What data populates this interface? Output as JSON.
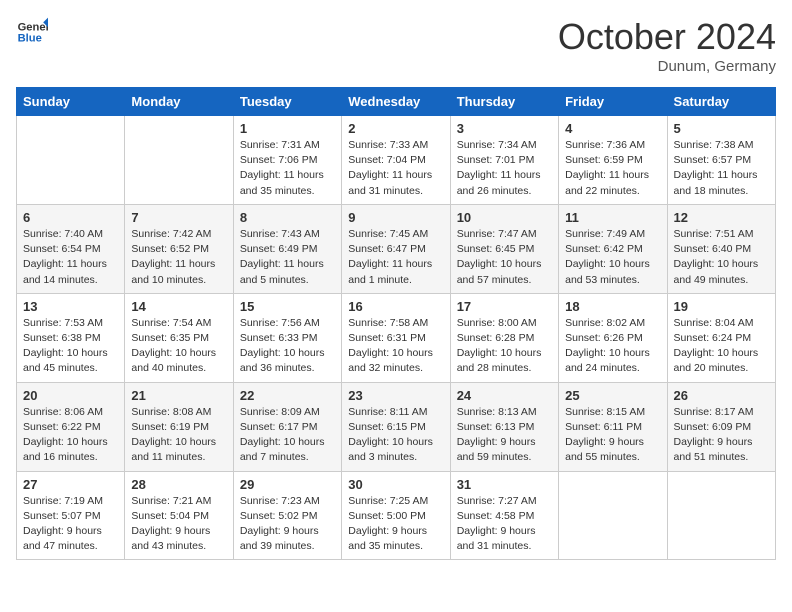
{
  "header": {
    "logo_general": "General",
    "logo_blue": "Blue",
    "title": "October 2024",
    "location": "Dunum, Germany"
  },
  "weekdays": [
    "Sunday",
    "Monday",
    "Tuesday",
    "Wednesday",
    "Thursday",
    "Friday",
    "Saturday"
  ],
  "weeks": [
    [
      {
        "day": "",
        "info": ""
      },
      {
        "day": "",
        "info": ""
      },
      {
        "day": "1",
        "info": "Sunrise: 7:31 AM\nSunset: 7:06 PM\nDaylight: 11 hours and 35 minutes."
      },
      {
        "day": "2",
        "info": "Sunrise: 7:33 AM\nSunset: 7:04 PM\nDaylight: 11 hours and 31 minutes."
      },
      {
        "day": "3",
        "info": "Sunrise: 7:34 AM\nSunset: 7:01 PM\nDaylight: 11 hours and 26 minutes."
      },
      {
        "day": "4",
        "info": "Sunrise: 7:36 AM\nSunset: 6:59 PM\nDaylight: 11 hours and 22 minutes."
      },
      {
        "day": "5",
        "info": "Sunrise: 7:38 AM\nSunset: 6:57 PM\nDaylight: 11 hours and 18 minutes."
      }
    ],
    [
      {
        "day": "6",
        "info": "Sunrise: 7:40 AM\nSunset: 6:54 PM\nDaylight: 11 hours and 14 minutes."
      },
      {
        "day": "7",
        "info": "Sunrise: 7:42 AM\nSunset: 6:52 PM\nDaylight: 11 hours and 10 minutes."
      },
      {
        "day": "8",
        "info": "Sunrise: 7:43 AM\nSunset: 6:49 PM\nDaylight: 11 hours and 5 minutes."
      },
      {
        "day": "9",
        "info": "Sunrise: 7:45 AM\nSunset: 6:47 PM\nDaylight: 11 hours and 1 minute."
      },
      {
        "day": "10",
        "info": "Sunrise: 7:47 AM\nSunset: 6:45 PM\nDaylight: 10 hours and 57 minutes."
      },
      {
        "day": "11",
        "info": "Sunrise: 7:49 AM\nSunset: 6:42 PM\nDaylight: 10 hours and 53 minutes."
      },
      {
        "day": "12",
        "info": "Sunrise: 7:51 AM\nSunset: 6:40 PM\nDaylight: 10 hours and 49 minutes."
      }
    ],
    [
      {
        "day": "13",
        "info": "Sunrise: 7:53 AM\nSunset: 6:38 PM\nDaylight: 10 hours and 45 minutes."
      },
      {
        "day": "14",
        "info": "Sunrise: 7:54 AM\nSunset: 6:35 PM\nDaylight: 10 hours and 40 minutes."
      },
      {
        "day": "15",
        "info": "Sunrise: 7:56 AM\nSunset: 6:33 PM\nDaylight: 10 hours and 36 minutes."
      },
      {
        "day": "16",
        "info": "Sunrise: 7:58 AM\nSunset: 6:31 PM\nDaylight: 10 hours and 32 minutes."
      },
      {
        "day": "17",
        "info": "Sunrise: 8:00 AM\nSunset: 6:28 PM\nDaylight: 10 hours and 28 minutes."
      },
      {
        "day": "18",
        "info": "Sunrise: 8:02 AM\nSunset: 6:26 PM\nDaylight: 10 hours and 24 minutes."
      },
      {
        "day": "19",
        "info": "Sunrise: 8:04 AM\nSunset: 6:24 PM\nDaylight: 10 hours and 20 minutes."
      }
    ],
    [
      {
        "day": "20",
        "info": "Sunrise: 8:06 AM\nSunset: 6:22 PM\nDaylight: 10 hours and 16 minutes."
      },
      {
        "day": "21",
        "info": "Sunrise: 8:08 AM\nSunset: 6:19 PM\nDaylight: 10 hours and 11 minutes."
      },
      {
        "day": "22",
        "info": "Sunrise: 8:09 AM\nSunset: 6:17 PM\nDaylight: 10 hours and 7 minutes."
      },
      {
        "day": "23",
        "info": "Sunrise: 8:11 AM\nSunset: 6:15 PM\nDaylight: 10 hours and 3 minutes."
      },
      {
        "day": "24",
        "info": "Sunrise: 8:13 AM\nSunset: 6:13 PM\nDaylight: 9 hours and 59 minutes."
      },
      {
        "day": "25",
        "info": "Sunrise: 8:15 AM\nSunset: 6:11 PM\nDaylight: 9 hours and 55 minutes."
      },
      {
        "day": "26",
        "info": "Sunrise: 8:17 AM\nSunset: 6:09 PM\nDaylight: 9 hours and 51 minutes."
      }
    ],
    [
      {
        "day": "27",
        "info": "Sunrise: 7:19 AM\nSunset: 5:07 PM\nDaylight: 9 hours and 47 minutes."
      },
      {
        "day": "28",
        "info": "Sunrise: 7:21 AM\nSunset: 5:04 PM\nDaylight: 9 hours and 43 minutes."
      },
      {
        "day": "29",
        "info": "Sunrise: 7:23 AM\nSunset: 5:02 PM\nDaylight: 9 hours and 39 minutes."
      },
      {
        "day": "30",
        "info": "Sunrise: 7:25 AM\nSunset: 5:00 PM\nDaylight: 9 hours and 35 minutes."
      },
      {
        "day": "31",
        "info": "Sunrise: 7:27 AM\nSunset: 4:58 PM\nDaylight: 9 hours and 31 minutes."
      },
      {
        "day": "",
        "info": ""
      },
      {
        "day": "",
        "info": ""
      }
    ]
  ]
}
